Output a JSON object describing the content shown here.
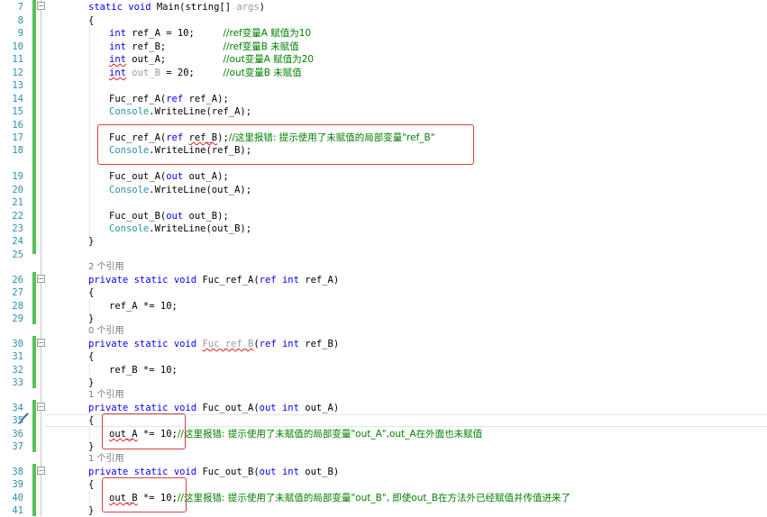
{
  "line_numbers": [
    "7",
    "8",
    "9",
    "10",
    "11",
    "12",
    "13",
    "14",
    "15",
    "16",
    "17",
    "18",
    "19",
    "20",
    "21",
    "22",
    "23",
    "24",
    "25",
    "26",
    "27",
    "28",
    "29",
    "30",
    "31",
    "32",
    "33",
    "34",
    "35",
    "36",
    "37",
    "38",
    "39",
    "40",
    "41"
  ],
  "code": {
    "l7_kw": "static void ",
    "l7_name": "Main(string[] ",
    "l7_args": "args",
    "l7_close": ")",
    "l8": "{",
    "l9_kw": "int",
    "l9_code": " ref_A = 10;     ",
    "l9_cmt": "//ref变量A 赋值为10",
    "l10_kw": "int",
    "l10_code": " ref_B;          ",
    "l10_cmt": "//ref变量B 未赋值",
    "l11_kw": "int",
    "l11_code": " out_A;          ",
    "l11_cmt": "//out变量A 赋值为20",
    "l12_kw": "int",
    "l12_var": "out_B",
    "l12_code": " = 20;     ",
    "l12_cmt": "//out变量B 未赋值",
    "l14_a": "Fuc_ref_A(",
    "l14_kw": "ref",
    "l14_b": " ref_A);",
    "l15_cls": "Console",
    "l15_rest": ".WriteLine(ref_A);",
    "l17_a": "Fuc_ref_A(",
    "l17_kw": "ref",
    "l17_space": " ",
    "l17_var": "ref_B",
    "l17_b": ");",
    "l17_cmt": "//这里报错: 提示使用了未赋值的局部变量\"ref_B\"",
    "l18_cls": "Console",
    "l18_rest": ".WriteLine(ref_B);",
    "l20_a": "Fuc_out_A(",
    "l20_kw": "out",
    "l20_b": " out_A);",
    "l21_cls": "Console",
    "l21_rest": ".WriteLine(out_A);",
    "l23_a": "Fuc_out_B(",
    "l23_kw": "out",
    "l23_b": " out_B);",
    "l24_cls": "Console",
    "l24_rest": ".WriteLine(out_B);",
    "l25": "}",
    "lens_ref_A": "2 个引用",
    "l27_kw": "private static void ",
    "l27_name": "Fuc_ref_A(",
    "l27_kw2": "ref int",
    "l27_rest": " ref_A)",
    "l28": "{",
    "l29": "ref_A *= 10;",
    "l30": "}",
    "lens_ref_B": "0 个引用",
    "l31_kw": "private static void ",
    "l31_name": "Fuc_ref_B",
    "l31_open": "(",
    "l31_kw2": "ref int",
    "l31_rest": " ref_B)",
    "l32": "{",
    "l33": "ref_B *= 10;",
    "l34": "}",
    "lens_out_A": "1 个引用",
    "l35_kw": "private static void ",
    "l35_name": "Fuc_out_A(",
    "l35_kw2": "out int",
    "l35_rest": " out_A)",
    "l36": "{",
    "l37_var": "out_A",
    "l37_code": " *= 10;",
    "l37_cmt": "//这里报错: 提示使用了未赋值的局部变量\"out_A\",out_A在外面也未赋值",
    "l38": "}",
    "lens_out_B": "1 个引用",
    "l39_kw": "private static void ",
    "l39_name": "Fuc_out_B(",
    "l39_kw2": "out int",
    "l39_rest": " out_B)",
    "l40": "{",
    "l41_var": "out_B",
    "l41_code": " *= 10;",
    "l41_cmt": "//这里报错: 提示使用了未赋值的局部变量\"out_B\", 即使out_B在方法外已经赋值并传值进来了",
    "l42": "}"
  },
  "icons": {
    "gutter": "brush-icon"
  },
  "colors": {
    "keyword": "#0000ff",
    "type": "#2b91af",
    "comment": "#008000",
    "line_number": "#2b91af",
    "change_bar": "#57c15a",
    "highlight_box": "#d64040",
    "error_squiggle": "#e02020"
  }
}
